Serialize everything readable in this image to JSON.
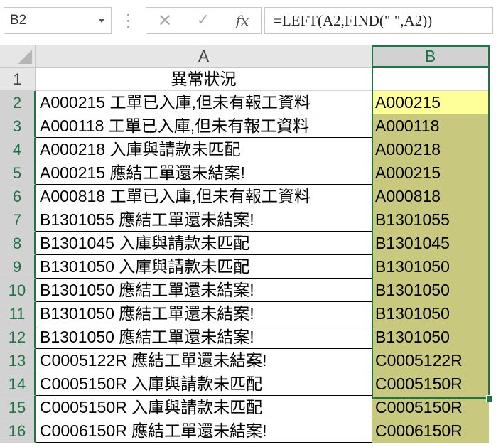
{
  "formula_bar": {
    "name_box": "B2",
    "formula": "=LEFT(A2,FIND(\" \",A2))",
    "cancel_glyph": "✕",
    "enter_glyph": "✓",
    "insert_function_label": "fx"
  },
  "columns": [
    "A",
    "B"
  ],
  "rows": [
    {
      "num": "1",
      "a": "異常狀況",
      "b": ""
    },
    {
      "num": "2",
      "a": "A000215 工單已入庫,但未有報工資料",
      "b": "A000215"
    },
    {
      "num": "3",
      "a": "A000118 工單已入庫,但未有報工資料",
      "b": "A000118"
    },
    {
      "num": "4",
      "a": "A000218 入庫與請款未匹配",
      "b": "A000218"
    },
    {
      "num": "5",
      "a": "A000215 應結工單還未結案!",
      "b": "A000215"
    },
    {
      "num": "6",
      "a": "A000818 工單已入庫,但未有報工資料",
      "b": "A000818"
    },
    {
      "num": "7",
      "a": "B1301055 應結工單還未結案!",
      "b": "B1301055"
    },
    {
      "num": "8",
      "a": "B1301045 入庫與請款未匹配",
      "b": "B1301045"
    },
    {
      "num": "9",
      "a": "B1301050 入庫與請款未匹配",
      "b": "B1301050"
    },
    {
      "num": "10",
      "a": "B1301050 應結工單還未結案!",
      "b": "B1301050"
    },
    {
      "num": "11",
      "a": "B1301050 應結工單還未結案!",
      "b": "B1301050"
    },
    {
      "num": "12",
      "a": "B1301050 應結工單還未結案!",
      "b": "B1301050"
    },
    {
      "num": "13",
      "a": "C0005122R 應結工單還未結案!",
      "b": "C0005122R"
    },
    {
      "num": "14",
      "a": "C0005150R 入庫與請款未匹配",
      "b": "C0005150R"
    },
    {
      "num": "15",
      "a": "C0005150R 入庫與請款未匹配",
      "b": "C0005150R"
    },
    {
      "num": "16",
      "a": "C0006150R 應結工單還未結案!",
      "b": "C0006150R"
    }
  ],
  "colors": {
    "accent": "#217346",
    "selection_fill": "#c8c87e",
    "active_cell_fill": "#ffff99"
  }
}
